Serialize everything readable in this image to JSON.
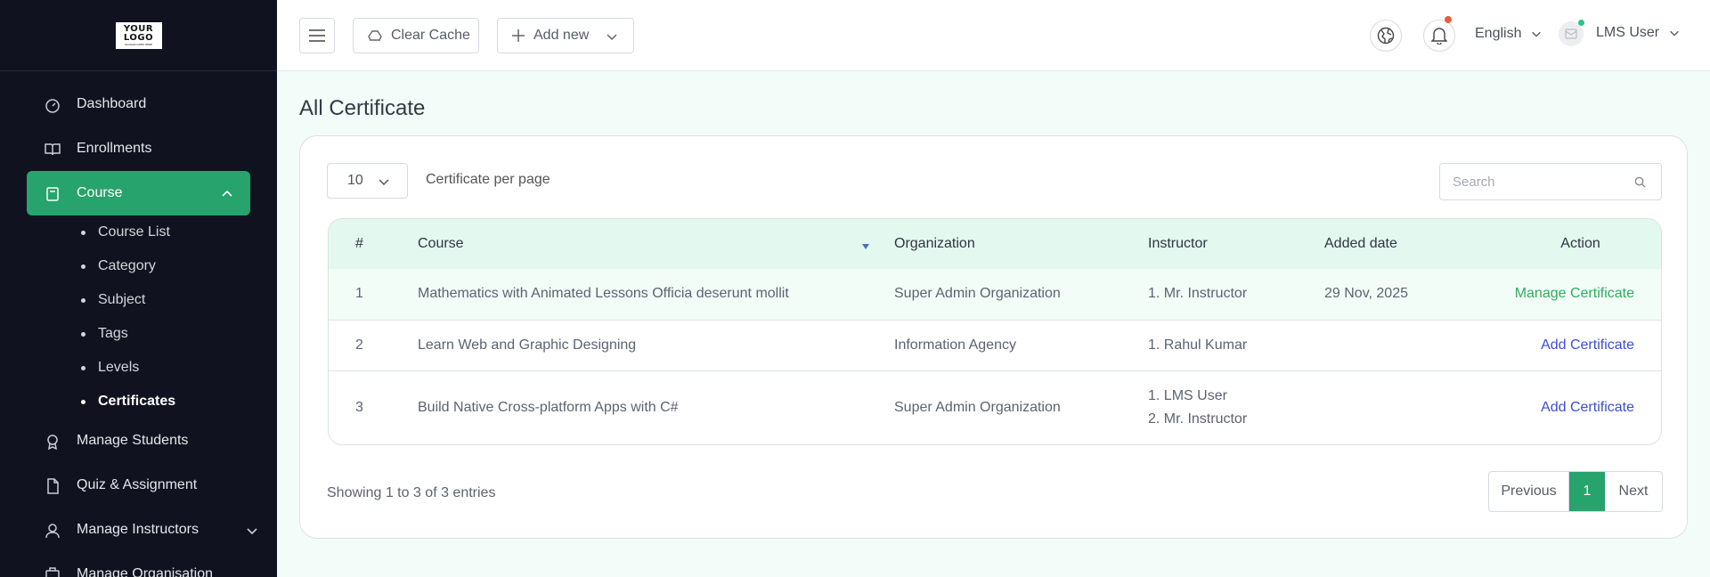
{
  "logo": {
    "line1": "YOUR",
    "line2": "LOGO",
    "tagline": "SLOGAN GOES HERE"
  },
  "sidebar": {
    "items": [
      {
        "label": "Dashboard",
        "icon": "gauge-icon"
      },
      {
        "label": "Enrollments",
        "icon": "book-open-icon"
      },
      {
        "label": "Course",
        "icon": "book-icon",
        "active": true,
        "expanded": true
      },
      {
        "label": "Manage Students",
        "icon": "award-icon"
      },
      {
        "label": "Quiz & Assignment",
        "icon": "file-icon"
      },
      {
        "label": "Manage Instructors",
        "icon": "user-icon"
      },
      {
        "label": "Manage Organisation",
        "icon": "building-icon"
      }
    ],
    "course_subitems": [
      "Course List",
      "Category",
      "Subject",
      "Tags",
      "Levels",
      "Certificates"
    ],
    "current_subitem": "Certificates"
  },
  "topbar": {
    "clear_cache": "Clear Cache",
    "add_new": "Add new",
    "language": "English",
    "user": "LMS User"
  },
  "page": {
    "title": "All Certificate",
    "per_page_value": "10",
    "per_page_label": "Certificate per page",
    "search_placeholder": "Search"
  },
  "table": {
    "headers": [
      "#",
      "Course",
      "Organization",
      "Instructor",
      "Added date",
      "Action"
    ],
    "rows": [
      {
        "num": "1",
        "course": "Mathematics with Animated Lessons Officia deserunt mollit",
        "org": "Super Admin Organization",
        "instructors": [
          "1. Mr. Instructor"
        ],
        "date": "29 Nov, 2025",
        "action": "Manage Certificate"
      },
      {
        "num": "2",
        "course": "Learn Web and Graphic Designing",
        "org": "Information Agency",
        "instructors": [
          "1. Rahul Kumar"
        ],
        "date": "",
        "action": "Add Certificate"
      },
      {
        "num": "3",
        "course": "Build Native Cross-platform Apps with C#",
        "org": "Super Admin Organization",
        "instructors": [
          "1. LMS User",
          "2. Mr. Instructor"
        ],
        "date": "",
        "action": "Add Certificate"
      }
    ]
  },
  "footer": {
    "showing": "Showing 1 to 3 of 3 entries",
    "previous": "Previous",
    "current_page": "1",
    "next": "Next"
  },
  "colors": {
    "accent": "#27a36d",
    "sidebar_bg": "#10131f",
    "header_row": "#e3f8ef",
    "link_add": "#3a4fd0",
    "link_manage": "#2eac5c"
  }
}
